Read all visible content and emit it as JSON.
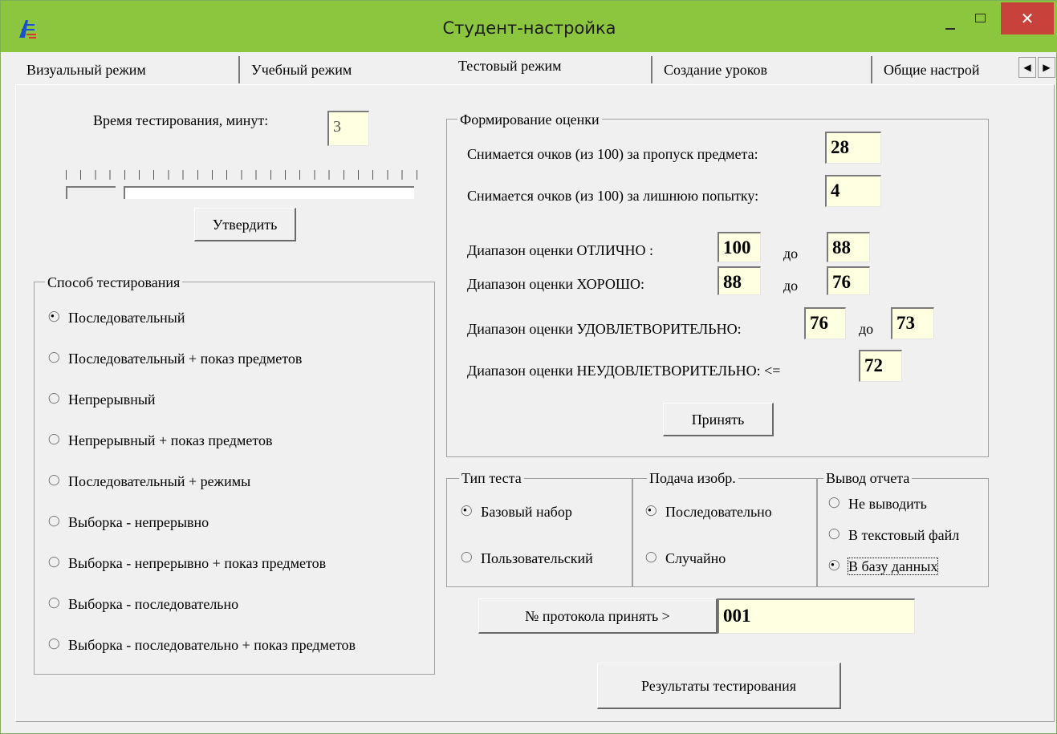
{
  "window": {
    "title": "Студент-настройка",
    "close_glyph": "✕",
    "colors": {
      "titlebar": "#8cc63f",
      "close": "#c7423b",
      "field_bg": "#ffffe1"
    }
  },
  "tabs": [
    {
      "label": "Визуальный режим",
      "active": false
    },
    {
      "label": "Учебный режим",
      "active": false
    },
    {
      "label": "Тестовый режим",
      "active": true
    },
    {
      "label": "Создание уроков",
      "active": false
    },
    {
      "label": "Общие настрой",
      "active": false
    }
  ],
  "tab_arrows": {
    "left": "◀",
    "right": "▶"
  },
  "test_time": {
    "label": "Время тестирования, минут:",
    "value": "3",
    "confirm_label": "Утвердить"
  },
  "method_group": {
    "title": "Способ тестирования",
    "options": [
      {
        "label": "Последовательный",
        "selected": true
      },
      {
        "label": "Последовательный + показ предметов",
        "selected": false
      },
      {
        "label": "Непрерывный",
        "selected": false
      },
      {
        "label": "Непрерывный + показ предметов",
        "selected": false
      },
      {
        "label": "Последовательный + режимы",
        "selected": false
      },
      {
        "label": "Выборка - непрерывно",
        "selected": false
      },
      {
        "label": "Выборка  - непрерывно + показ предметов",
        "selected": false
      },
      {
        "label": "Выборка - последовательно",
        "selected": false
      },
      {
        "label": "Выборка - последовательно + показ предметов",
        "selected": false
      }
    ]
  },
  "grading": {
    "title": "Формирование оценки",
    "skip_label": "Снимается очков (из 100) за пропуск предмета:",
    "skip_value": "28",
    "extra_label": "Снимается очков (из 100) за лишнюю попытку:",
    "extra_value": "4",
    "to_label": "до",
    "excellent_label": "Диапазон оценки ОТЛИЧНО :",
    "excellent_from": "100",
    "excellent_to": "88",
    "good_label": "Диапазон оценки ХОРОШО:",
    "good_from": "88",
    "good_to": "76",
    "satisfactory_label": "Диапазон оценки УДОВЛЕТВОРИТЕЛЬНО:",
    "satisfactory_from": "76",
    "satisfactory_to": "73",
    "unsatisfactory_label": "Диапазон оценки НЕУДОВЛЕТВОРИТЕЛЬНО: <=",
    "unsatisfactory_value": "72",
    "accept_label": "Принять"
  },
  "test_type": {
    "title": "Тип теста",
    "options": [
      {
        "label": "Базовый набор",
        "selected": true
      },
      {
        "label": "Пользовательский",
        "selected": false
      }
    ]
  },
  "image_feed": {
    "title": "Подача  изобр.",
    "options": [
      {
        "label": "Последовательно",
        "selected": true
      },
      {
        "label": "Случайно",
        "selected": false
      }
    ]
  },
  "report_output": {
    "title": "Вывод отчета",
    "options": [
      {
        "label": "Не выводить",
        "selected": false
      },
      {
        "label": "В текстовый файл",
        "selected": false
      },
      {
        "label": "В базу данных",
        "selected": true
      }
    ]
  },
  "protocol": {
    "button_label": "№ протокола принять >",
    "value": "001"
  },
  "results_button": "Результаты тестирования"
}
